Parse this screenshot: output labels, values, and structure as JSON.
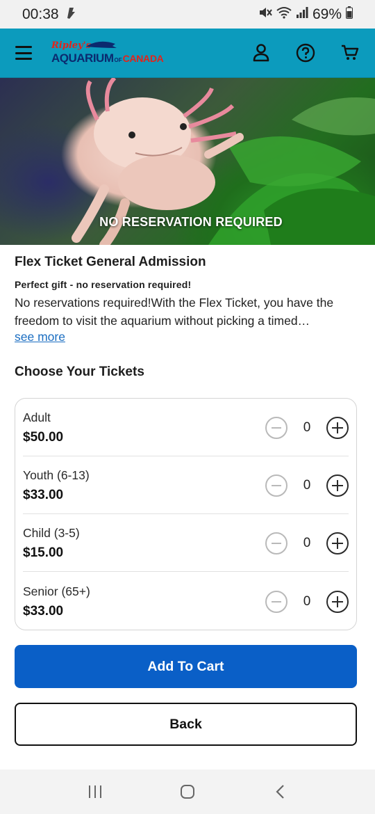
{
  "status_bar": {
    "time": "00:38",
    "battery": "69%"
  },
  "header": {
    "logo": {
      "ripleys": "Ripley's",
      "aquarium": "AQUARIUM",
      "of": "OF",
      "canada": "CANADA"
    },
    "icons": [
      "menu-icon",
      "account-icon",
      "help-icon",
      "cart-icon"
    ]
  },
  "hero": {
    "caption": "NO RESERVATION REQUIRED"
  },
  "product": {
    "title": "Flex Ticket General Admission",
    "subtitle": "Perfect gift - no reservation required!",
    "description": "No reservations required!With the Flex Ticket, you have the freedom to visit the aquarium without picking a timed…",
    "see_more": "see more"
  },
  "tickets_section": {
    "title": "Choose Your Tickets",
    "items": [
      {
        "name": "Adult",
        "price": "$50.00",
        "quantity": "0"
      },
      {
        "name": "Youth (6-13)",
        "price": "$33.00",
        "quantity": "0"
      },
      {
        "name": "Child (3-5)",
        "price": "$15.00",
        "quantity": "0"
      },
      {
        "name": "Senior (65+)",
        "price": "$33.00",
        "quantity": "0"
      }
    ]
  },
  "actions": {
    "add_to_cart": "Add To Cart",
    "back": "Back"
  },
  "colors": {
    "header_bg": "#0c9bbd",
    "primary_button": "#0a5fc7",
    "link": "#1a6dc1"
  }
}
